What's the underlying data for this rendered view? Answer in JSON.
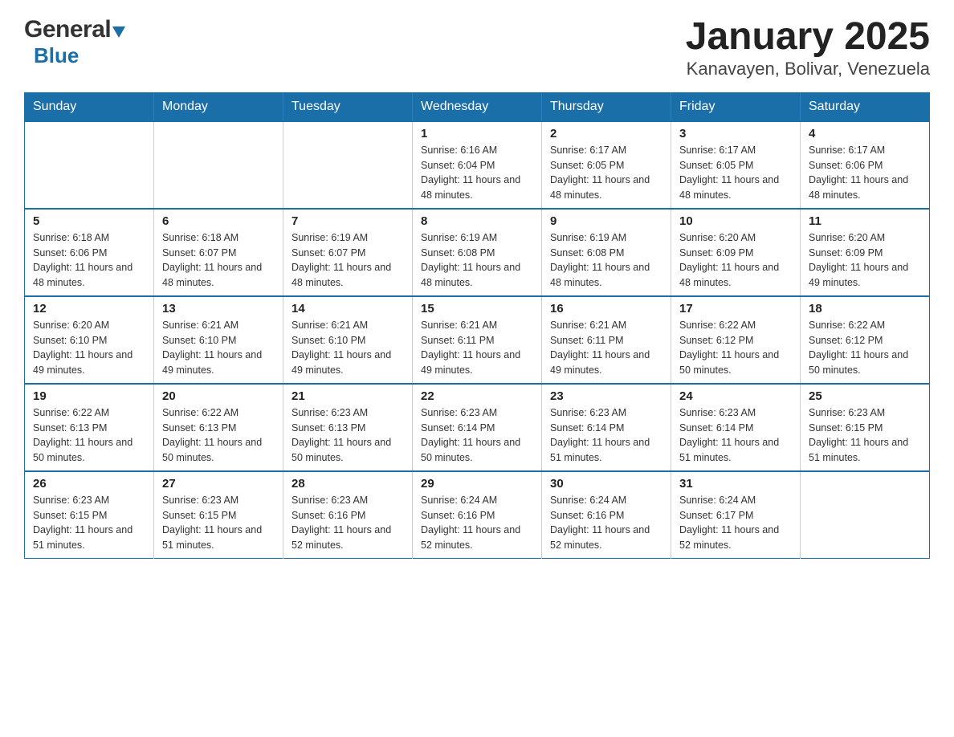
{
  "logo": {
    "general": "General",
    "blue": "Blue",
    "arrow": "▼"
  },
  "title": "January 2025",
  "subtitle": "Kanavayen, Bolivar, Venezuela",
  "days_of_week": [
    "Sunday",
    "Monday",
    "Tuesday",
    "Wednesday",
    "Thursday",
    "Friday",
    "Saturday"
  ],
  "weeks": [
    [
      {
        "day": "",
        "info": ""
      },
      {
        "day": "",
        "info": ""
      },
      {
        "day": "",
        "info": ""
      },
      {
        "day": "1",
        "info": "Sunrise: 6:16 AM\nSunset: 6:04 PM\nDaylight: 11 hours and 48 minutes."
      },
      {
        "day": "2",
        "info": "Sunrise: 6:17 AM\nSunset: 6:05 PM\nDaylight: 11 hours and 48 minutes."
      },
      {
        "day": "3",
        "info": "Sunrise: 6:17 AM\nSunset: 6:05 PM\nDaylight: 11 hours and 48 minutes."
      },
      {
        "day": "4",
        "info": "Sunrise: 6:17 AM\nSunset: 6:06 PM\nDaylight: 11 hours and 48 minutes."
      }
    ],
    [
      {
        "day": "5",
        "info": "Sunrise: 6:18 AM\nSunset: 6:06 PM\nDaylight: 11 hours and 48 minutes."
      },
      {
        "day": "6",
        "info": "Sunrise: 6:18 AM\nSunset: 6:07 PM\nDaylight: 11 hours and 48 minutes."
      },
      {
        "day": "7",
        "info": "Sunrise: 6:19 AM\nSunset: 6:07 PM\nDaylight: 11 hours and 48 minutes."
      },
      {
        "day": "8",
        "info": "Sunrise: 6:19 AM\nSunset: 6:08 PM\nDaylight: 11 hours and 48 minutes."
      },
      {
        "day": "9",
        "info": "Sunrise: 6:19 AM\nSunset: 6:08 PM\nDaylight: 11 hours and 48 minutes."
      },
      {
        "day": "10",
        "info": "Sunrise: 6:20 AM\nSunset: 6:09 PM\nDaylight: 11 hours and 48 minutes."
      },
      {
        "day": "11",
        "info": "Sunrise: 6:20 AM\nSunset: 6:09 PM\nDaylight: 11 hours and 49 minutes."
      }
    ],
    [
      {
        "day": "12",
        "info": "Sunrise: 6:20 AM\nSunset: 6:10 PM\nDaylight: 11 hours and 49 minutes."
      },
      {
        "day": "13",
        "info": "Sunrise: 6:21 AM\nSunset: 6:10 PM\nDaylight: 11 hours and 49 minutes."
      },
      {
        "day": "14",
        "info": "Sunrise: 6:21 AM\nSunset: 6:10 PM\nDaylight: 11 hours and 49 minutes."
      },
      {
        "day": "15",
        "info": "Sunrise: 6:21 AM\nSunset: 6:11 PM\nDaylight: 11 hours and 49 minutes."
      },
      {
        "day": "16",
        "info": "Sunrise: 6:21 AM\nSunset: 6:11 PM\nDaylight: 11 hours and 49 minutes."
      },
      {
        "day": "17",
        "info": "Sunrise: 6:22 AM\nSunset: 6:12 PM\nDaylight: 11 hours and 50 minutes."
      },
      {
        "day": "18",
        "info": "Sunrise: 6:22 AM\nSunset: 6:12 PM\nDaylight: 11 hours and 50 minutes."
      }
    ],
    [
      {
        "day": "19",
        "info": "Sunrise: 6:22 AM\nSunset: 6:13 PM\nDaylight: 11 hours and 50 minutes."
      },
      {
        "day": "20",
        "info": "Sunrise: 6:22 AM\nSunset: 6:13 PM\nDaylight: 11 hours and 50 minutes."
      },
      {
        "day": "21",
        "info": "Sunrise: 6:23 AM\nSunset: 6:13 PM\nDaylight: 11 hours and 50 minutes."
      },
      {
        "day": "22",
        "info": "Sunrise: 6:23 AM\nSunset: 6:14 PM\nDaylight: 11 hours and 50 minutes."
      },
      {
        "day": "23",
        "info": "Sunrise: 6:23 AM\nSunset: 6:14 PM\nDaylight: 11 hours and 51 minutes."
      },
      {
        "day": "24",
        "info": "Sunrise: 6:23 AM\nSunset: 6:14 PM\nDaylight: 11 hours and 51 minutes."
      },
      {
        "day": "25",
        "info": "Sunrise: 6:23 AM\nSunset: 6:15 PM\nDaylight: 11 hours and 51 minutes."
      }
    ],
    [
      {
        "day": "26",
        "info": "Sunrise: 6:23 AM\nSunset: 6:15 PM\nDaylight: 11 hours and 51 minutes."
      },
      {
        "day": "27",
        "info": "Sunrise: 6:23 AM\nSunset: 6:15 PM\nDaylight: 11 hours and 51 minutes."
      },
      {
        "day": "28",
        "info": "Sunrise: 6:23 AM\nSunset: 6:16 PM\nDaylight: 11 hours and 52 minutes."
      },
      {
        "day": "29",
        "info": "Sunrise: 6:24 AM\nSunset: 6:16 PM\nDaylight: 11 hours and 52 minutes."
      },
      {
        "day": "30",
        "info": "Sunrise: 6:24 AM\nSunset: 6:16 PM\nDaylight: 11 hours and 52 minutes."
      },
      {
        "day": "31",
        "info": "Sunrise: 6:24 AM\nSunset: 6:17 PM\nDaylight: 11 hours and 52 minutes."
      },
      {
        "day": "",
        "info": ""
      }
    ]
  ]
}
